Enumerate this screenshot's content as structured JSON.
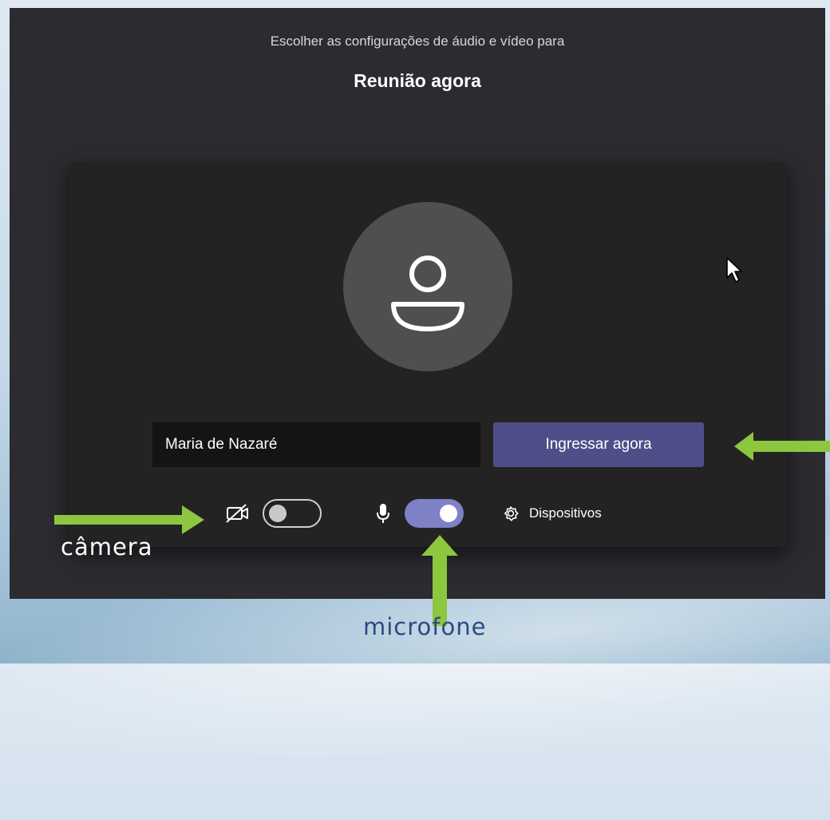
{
  "header": {
    "prompt": "Escolher as configurações de áudio e vídeo para",
    "meeting_title": "Reunião agora"
  },
  "join": {
    "name_value": "Maria de Nazaré",
    "join_label": "Ingressar agora"
  },
  "controls": {
    "camera": {
      "state": "off",
      "icon": "camera-off-icon"
    },
    "microphone": {
      "state": "on",
      "icon": "microphone-icon"
    },
    "devices_label": "Dispositivos",
    "devices_icon": "gear-icon"
  },
  "annotations": {
    "camera_label": "câmera",
    "microphone_label": "microfone",
    "arrow_color": "#8dc63f"
  },
  "colors": {
    "join_button": "#4e4f88",
    "toggle_on": "#7e81c6",
    "dialog_bg": "#2b2b30",
    "preview_bg": "#232323"
  }
}
